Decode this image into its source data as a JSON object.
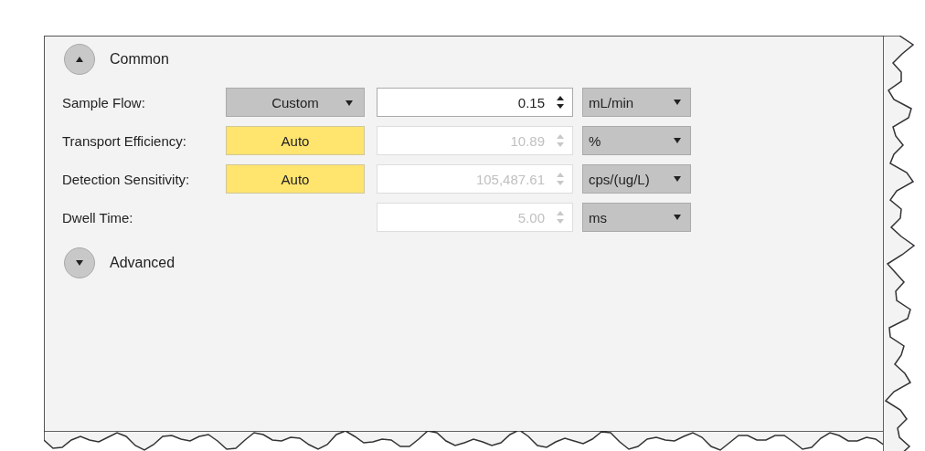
{
  "sections": [
    {
      "title": "Common",
      "expanded": true,
      "rows": [
        {
          "label": "Sample Flow:",
          "mode": {
            "kind": "dropdown",
            "value": "Custom"
          },
          "value": "0.15",
          "disabled": false,
          "unit": "mL/min"
        },
        {
          "label": "Transport Efficiency:",
          "mode": {
            "kind": "auto",
            "value": "Auto"
          },
          "value": "10.89",
          "disabled": true,
          "unit": "%"
        },
        {
          "label": "Detection Sensitivity:",
          "mode": {
            "kind": "auto",
            "value": "Auto"
          },
          "value": "105,487.61",
          "disabled": true,
          "unit": "cps/(ug/L)"
        },
        {
          "label": "Dwell Time:",
          "value": "5.00",
          "disabled": true,
          "unit": "ms"
        }
      ]
    },
    {
      "title": "Advanced",
      "expanded": false
    }
  ]
}
